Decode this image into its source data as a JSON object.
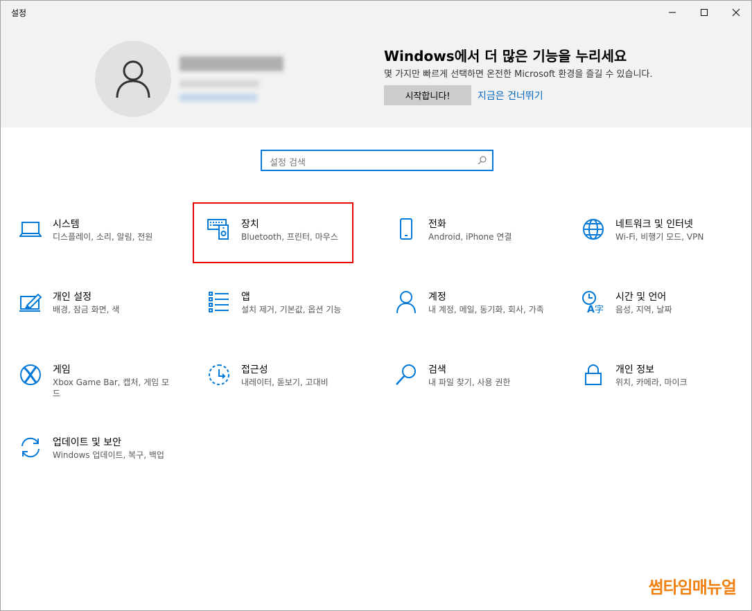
{
  "window": {
    "title": "설정"
  },
  "banner": {
    "promo_title": "Windows에서 더 많은 기능을 누리세요",
    "promo_subtitle": "몇 가지만 빠르게 선택하면 온전한 Microsoft 환경을 즐길 수 있습니다.",
    "start_button": "시작합니다!",
    "skip_link": "지금은 건너뛰기"
  },
  "search": {
    "placeholder": "설정 검색"
  },
  "tiles": [
    {
      "name": "시스템",
      "desc": "디스플레이, 소리, 알림, 전원",
      "icon": "laptop-icon"
    },
    {
      "name": "장치",
      "desc": "Bluetooth, 프린터, 마우스",
      "icon": "devices-icon"
    },
    {
      "name": "전화",
      "desc": "Android, iPhone 연결",
      "icon": "phone-icon"
    },
    {
      "name": "네트워크 및 인터넷",
      "desc": "Wi-Fi, 비행기 모드, VPN",
      "icon": "globe-icon"
    },
    {
      "name": "개인 설정",
      "desc": "배경, 잠금 화면, 색",
      "icon": "personalization-icon"
    },
    {
      "name": "앱",
      "desc": "설치 제거, 기본값, 옵션 기능",
      "icon": "apps-list-icon"
    },
    {
      "name": "계정",
      "desc": "내 계정, 메일, 동기화, 회사, 가족",
      "icon": "person-icon"
    },
    {
      "name": "시간 및 언어",
      "desc": "음성, 지역, 날짜",
      "icon": "time-language-icon"
    },
    {
      "name": "게임",
      "desc": "Xbox Game Bar, 캡처, 게임 모드",
      "icon": "xbox-icon"
    },
    {
      "name": "접근성",
      "desc": "내레이터, 돋보기, 고대비",
      "icon": "accessibility-icon"
    },
    {
      "name": "검색",
      "desc": "내 파일 찾기, 사용 권한",
      "icon": "search-icon"
    },
    {
      "name": "개인 정보",
      "desc": "위치, 카메라, 마이크",
      "icon": "lock-icon"
    },
    {
      "name": "업데이트 및 보안",
      "desc": "Windows 업데이트, 복구, 백업",
      "icon": "update-icon"
    }
  ],
  "watermark": "썸타임매뉴얼",
  "colors": {
    "accent": "#0078d7",
    "highlight": "#e60000",
    "watermark": "#f08010"
  }
}
